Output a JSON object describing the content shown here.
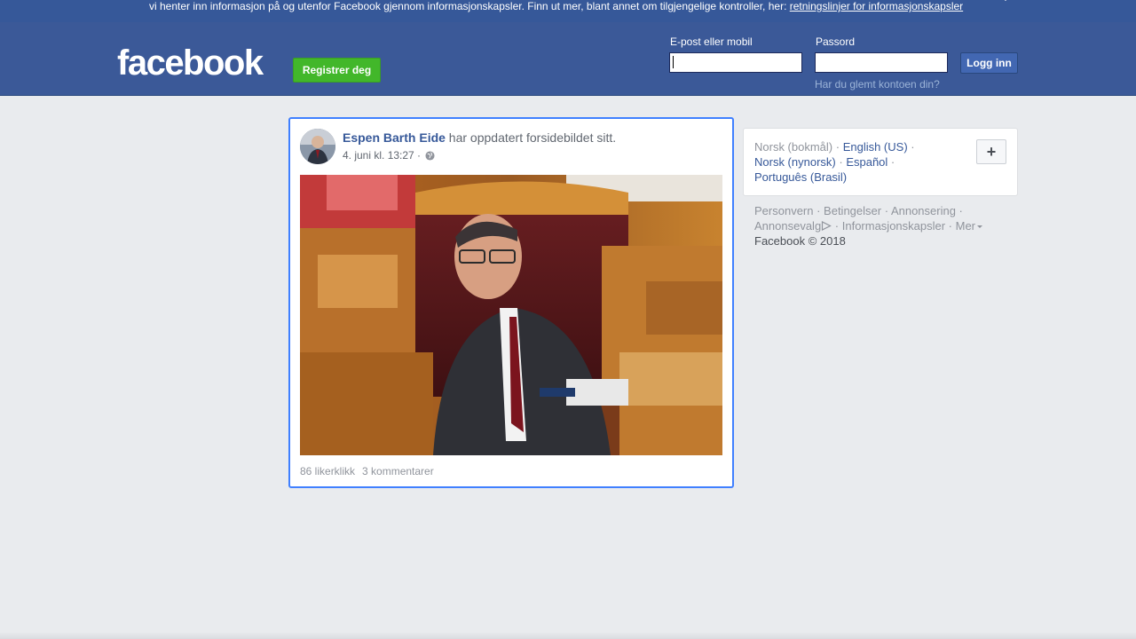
{
  "cookie_banner": {
    "text": "vi henter inn informasjon på og utenfor Facebook gjennom informasjonskapsler. Finn ut mer, blant annet om tilgjengelige kontroller, her: ",
    "link": "retningslinjer for informasjonskapsler",
    "close_icon": "close-icon"
  },
  "header": {
    "logo": "facebook",
    "register_button": "Registrer deg",
    "email_label": "E-post eller mobil",
    "email_value": "",
    "password_label": "Passord",
    "password_value": "",
    "login_button": "Logg inn",
    "forgot_link": "Har du glemt kontoen din?"
  },
  "post": {
    "author": "Espen Barth Eide",
    "action": " har oppdatert forsidebildet sitt.",
    "date": "4. juni kl. 13:27 · ",
    "privacy_icon": "globe-icon",
    "likes": "86 likerklikk",
    "comments": "3 kommentarer"
  },
  "languages": {
    "current": "Norsk (bokmål)",
    "sep": " · ",
    "options": [
      "English (US)",
      "Norsk (nynorsk)",
      "Español",
      "Português (Brasil)"
    ],
    "add_button": "+"
  },
  "footer": {
    "links": [
      "Personvern",
      "Betingelser",
      "Annonsering",
      "Annonsevalg",
      "Informasjonskapsler",
      "Mer"
    ],
    "copyright": "Facebook © 2018"
  },
  "colors": {
    "brand_blue": "#3b5998",
    "banner_blue": "#365899",
    "register_green": "#42b72a",
    "focus_border": "#4080ff",
    "page_bg": "#e9ebee"
  }
}
